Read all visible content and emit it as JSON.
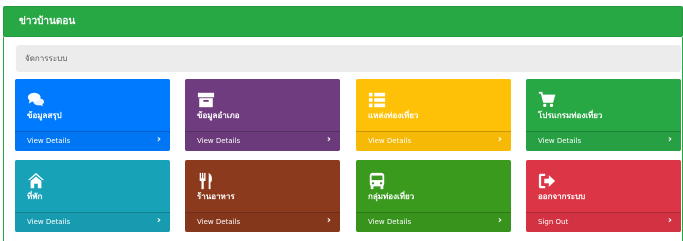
{
  "header": {
    "title": "ข่าวบ้านดอน"
  },
  "breadcrumb": {
    "text": "จัดการระบบ"
  },
  "cards": [
    {
      "title": "ข้อมูลสรุป",
      "link": "View Details",
      "color": "#007bff",
      "icon": "comments-icon"
    },
    {
      "title": "ข้อมูลอำเภอ",
      "link": "View Details",
      "color": "#6f3d7f",
      "icon": "archive-icon"
    },
    {
      "title": "แหล่งท่องเที่ยว",
      "link": "View Details",
      "color": "#ffc107",
      "icon": "list-icon"
    },
    {
      "title": "โปรแกรมท่องเที่ยว",
      "link": "View Details",
      "color": "#28a745",
      "icon": "cart-icon"
    },
    {
      "title": "ที่พัก",
      "link": "View Details",
      "color": "#17a2b8",
      "icon": "home-icon"
    },
    {
      "title": "ร้านอาหาร",
      "link": "View Details",
      "color": "#8b3a1e",
      "icon": "utensils-icon"
    },
    {
      "title": "กลุ่มท่องเที่ยว",
      "link": "View Details",
      "color": "#3a9a1e",
      "icon": "bus-icon"
    },
    {
      "title": "ออกจากระบบ",
      "link": "Sign Out",
      "color": "#dc3545",
      "icon": "sign-out-icon"
    }
  ]
}
